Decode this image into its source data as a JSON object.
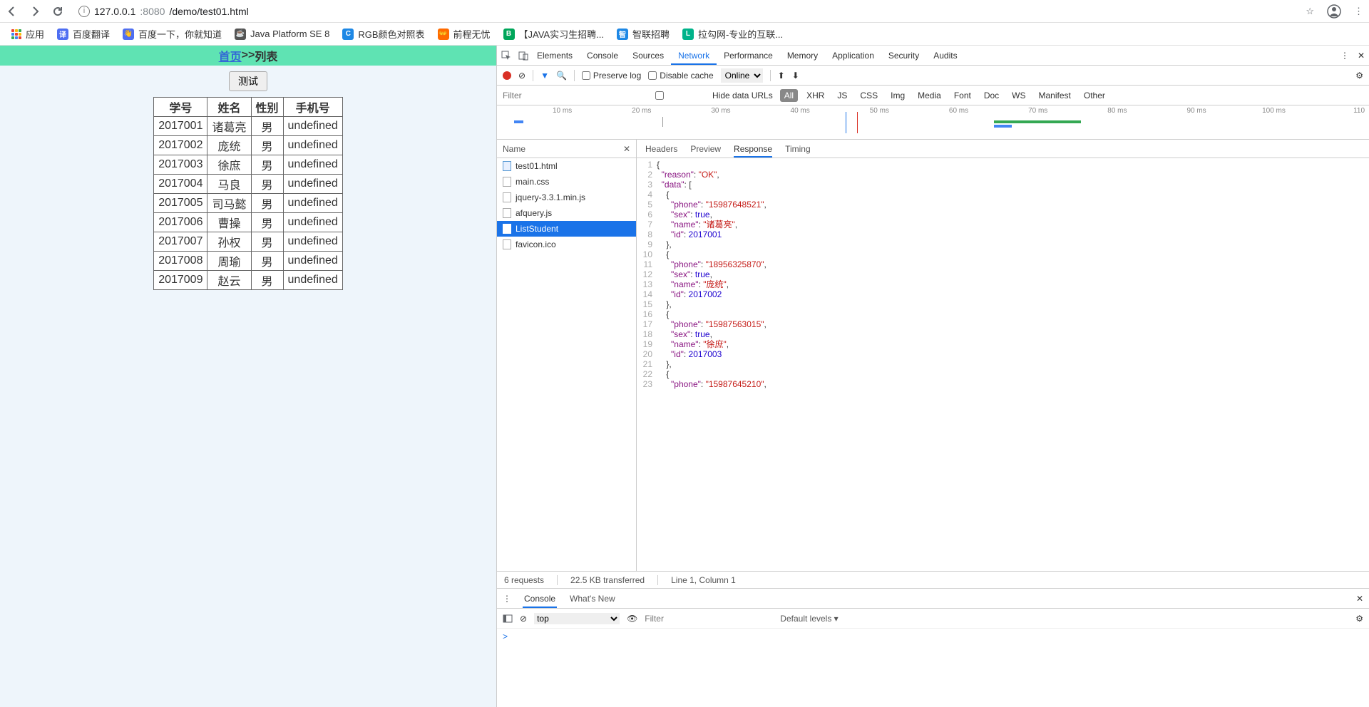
{
  "browser": {
    "url_ip": "127.0.0.1",
    "url_port": ":8080",
    "url_path": "/demo/test01.html"
  },
  "bookmarks": {
    "apps": "应用",
    "items": [
      {
        "label": "百度翻译",
        "bg": "#4e6ef2",
        "txt": "译"
      },
      {
        "label": "百度一下，你就知道",
        "bg": "#4e6ef2",
        "txt": "👋"
      },
      {
        "label": "Java Platform SE 8",
        "bg": "#555",
        "txt": "☕"
      },
      {
        "label": "RGB颜色对照表",
        "bg": "#1e88e5",
        "txt": "C"
      },
      {
        "label": "前程无忧",
        "bg": "#ff6a00",
        "txt": "👐"
      },
      {
        "label": "【JAVA实习生招聘...",
        "bg": "#00a65a",
        "txt": "B"
      },
      {
        "label": "智联招聘",
        "bg": "#1e88e5",
        "txt": "智"
      },
      {
        "label": "拉勾网-专业的互联...",
        "bg": "#00b38a",
        "txt": "L"
      }
    ]
  },
  "page": {
    "home_link": "首页",
    "sep": " >> ",
    "list_label": "列表",
    "test_btn": "测试",
    "headers": [
      "学号",
      "姓名",
      "性别",
      "手机号"
    ],
    "rows": [
      [
        "2017001",
        "诸葛亮",
        "男",
        "undefined"
      ],
      [
        "2017002",
        "庞统",
        "男",
        "undefined"
      ],
      [
        "2017003",
        "徐庶",
        "男",
        "undefined"
      ],
      [
        "2017004",
        "马良",
        "男",
        "undefined"
      ],
      [
        "2017005",
        "司马懿",
        "男",
        "undefined"
      ],
      [
        "2017006",
        "曹操",
        "男",
        "undefined"
      ],
      [
        "2017007",
        "孙权",
        "男",
        "undefined"
      ],
      [
        "2017008",
        "周瑜",
        "男",
        "undefined"
      ],
      [
        "2017009",
        "赵云",
        "男",
        "undefined"
      ]
    ]
  },
  "devtools": {
    "panels": [
      "Elements",
      "Console",
      "Sources",
      "Network",
      "Performance",
      "Memory",
      "Application",
      "Security",
      "Audits"
    ],
    "active_panel": "Network",
    "toolbar": {
      "preserve": "Preserve log",
      "disable_cache": "Disable cache",
      "throttle": "Online"
    },
    "filter": {
      "placeholder": "Filter",
      "hide_data": "Hide data URLs",
      "types": [
        "All",
        "XHR",
        "JS",
        "CSS",
        "Img",
        "Media",
        "Font",
        "Doc",
        "WS",
        "Manifest",
        "Other"
      ]
    },
    "timeline_labels": [
      "10 ms",
      "20 ms",
      "30 ms",
      "40 ms",
      "50 ms",
      "60 ms",
      "70 ms",
      "80 ms",
      "90 ms",
      "100 ms",
      "110"
    ],
    "name_hdr": "Name",
    "requests": [
      {
        "name": "test01.html",
        "kind": "html"
      },
      {
        "name": "main.css",
        "kind": "file"
      },
      {
        "name": "jquery-3.3.1.min.js",
        "kind": "file"
      },
      {
        "name": "afquery.js",
        "kind": "file"
      },
      {
        "name": "ListStudent",
        "kind": "file",
        "selected": true
      },
      {
        "name": "favicon.ico",
        "kind": "file"
      }
    ],
    "detail_tabs": [
      "Headers",
      "Preview",
      "Response",
      "Timing"
    ],
    "active_detail": "Response",
    "response_lines": [
      "{",
      "  \"reason\": \"OK\",",
      "  \"data\": [",
      "    {",
      "      \"phone\": \"15987648521\",",
      "      \"sex\": true,",
      "      \"name\": \"诸葛亮\",",
      "      \"id\": 2017001",
      "    },",
      "    {",
      "      \"phone\": \"18956325870\",",
      "      \"sex\": true,",
      "      \"name\": \"庞统\",",
      "      \"id\": 2017002",
      "    },",
      "    {",
      "      \"phone\": \"15987563015\",",
      "      \"sex\": true,",
      "      \"name\": \"徐庶\",",
      "      \"id\": 2017003",
      "    },",
      "    {",
      "      \"phone\": \"15987645210\","
    ],
    "status": {
      "requests": "6 requests",
      "transferred": "22.5 KB transferred",
      "cursor": "Line 1, Column 1"
    },
    "drawer": {
      "tabs": [
        "Console",
        "What's New"
      ],
      "context": "top",
      "filter_placeholder": "Filter",
      "levels": "Default levels ▾",
      "prompt": ">"
    }
  }
}
